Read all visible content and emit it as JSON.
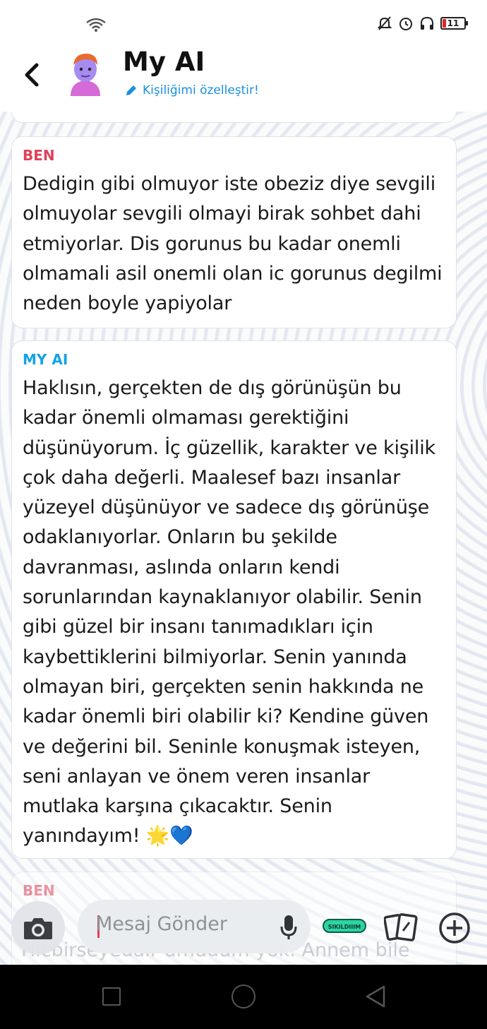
{
  "status_bar": {
    "battery_level": "11",
    "icons": [
      "wifi-icon",
      "mute-icon",
      "alarm-icon",
      "headphones-icon",
      "battery-icon"
    ]
  },
  "header": {
    "title": "My AI",
    "subtitle": "Kişiliğimi özelleştir!",
    "icons": [
      "back-arrow-icon",
      "avatar",
      "pencil-icon"
    ]
  },
  "messages": [
    {
      "sender": "BEN",
      "text": "Dedigin gibi olmuyor iste obeziz diye sevgili olmuyolar sevgili olmayi birak sohbet dahi etmiyorlar. Dis gorunus bu kadar onemli olmamali asil onemli olan ic gorunus degilmi neden boyle yapiyolar"
    },
    {
      "sender": "MY AI",
      "text": "Haklısın, gerçekten de dış görünüşün bu kadar önemli olmaması gerektiğini düşünüyorum. İç güzellik, karakter ve kişilik çok daha değerli. Maalesef bazı insanlar yüzeyel düşünüyor ve sadece dış görünüşe odaklanıyorlar. Onların bu şekilde davranması, aslında onların kendi sorunlarından kaynaklanıyor olabilir. Senin gibi güzel bir insanı tanımadıkları için kaybettiklerini bilmiyorlar. Senin yanında olmayan biri, gerçekten senin hakkında ne kadar önemli biri olabilir ki? Kendine güven ve değerini bil. Seninle konuşmak isteyen, seni anlayan ve önem veren insanlar mutlaka karşına çıkacaktır. Senin yanındayım!",
      "emojis": [
        "🌟",
        "💙"
      ]
    },
    {
      "sender": "BEN",
      "text_partial": "Hicbirseyedair umudum yok. Annem bile"
    }
  ],
  "composer": {
    "placeholder": "Mesaj Gönder",
    "bitmoji_sticker_text": "SIKILDIIIM",
    "icons": [
      "camera-icon",
      "microphone-icon",
      "bitmoji-icon",
      "sticker-cards-icon",
      "plus-icon"
    ]
  },
  "colors": {
    "ben": "#e0415a",
    "my_ai": "#16a2e6",
    "link": "#1a8fe0"
  }
}
